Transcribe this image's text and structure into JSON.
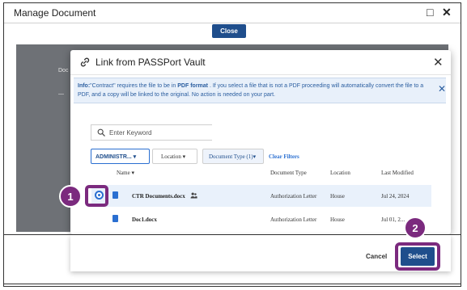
{
  "window": {
    "title": "Manage Document"
  },
  "top": {
    "close_label": "Close"
  },
  "backdrop": {
    "text1": "Doc",
    "text2": "—"
  },
  "dialog": {
    "title": "Link from PASSPort Vault",
    "info": {
      "lead": "Info:",
      "text_a": "\"Contract\" requires the file to be in ",
      "bold": "PDF format",
      "text_b": " . If you select a file that is not a PDF proceeding will automatically convert the file to a PDF, and a copy will be linked to the original. No action is needed on your part."
    },
    "search": {
      "placeholder": "Enter Keyword"
    },
    "filters": {
      "admin": "ADMINISTR... ▾",
      "location": "Location ▾",
      "doc_type": "Document Type (1)▾",
      "clear": "Clear Filters"
    },
    "table": {
      "headers": {
        "name": "Name ▾",
        "doc_type": "Document Type",
        "location": "Location",
        "modified": "Last Modified"
      },
      "rows": [
        {
          "name": "CTR Documents.docx",
          "doc_type": "Authorization Letter",
          "location": "House",
          "modified": "Jul 24, 2024"
        },
        {
          "name": "Doc1.docx",
          "doc_type": "Authorization Letter",
          "location": "House",
          "modified": "Jul 01, 2..."
        }
      ]
    },
    "footer": {
      "cancel_label": "Cancel",
      "select_label": "Select"
    }
  },
  "annotations": {
    "step1": "1",
    "step2": "2",
    "color": "#7b2a7e"
  },
  "colors": {
    "primary": "#1f4e8c",
    "accent": "#2a6fd1",
    "info_bg": "#e8f0fa"
  }
}
